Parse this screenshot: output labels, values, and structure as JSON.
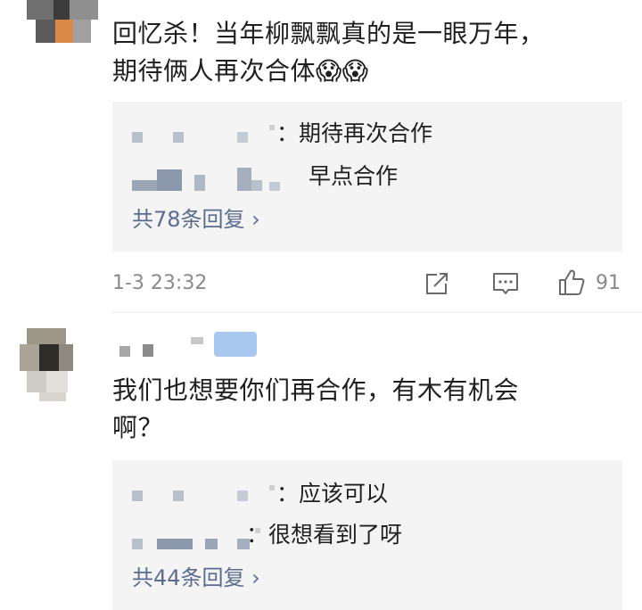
{
  "comment1": {
    "text_line1": "回忆杀！当年柳飘飘真的是一眼万年，",
    "text_line2": "期待俩人再次合体😱😱",
    "replies": [
      {
        "text": "：期待再次合作"
      },
      {
        "text": "早点合作"
      }
    ],
    "reply_count": "共78条回复 ›",
    "timestamp": "1-3 23:32",
    "like_count": "91"
  },
  "comment2": {
    "text_line1": "我们也想要你们再合作，有木有机会",
    "text_line2": "啊？",
    "replies": [
      {
        "text": "：应该可以"
      },
      {
        "text": "：很想看到了呀"
      }
    ],
    "reply_count": "共44条回复 ›"
  },
  "icons": [
    "share-icon",
    "comment-icon",
    "like-icon"
  ],
  "colors": {
    "link": "#5b6c8f",
    "reply_bg": "#f4f4f4",
    "meta": "#8a8a8a"
  }
}
